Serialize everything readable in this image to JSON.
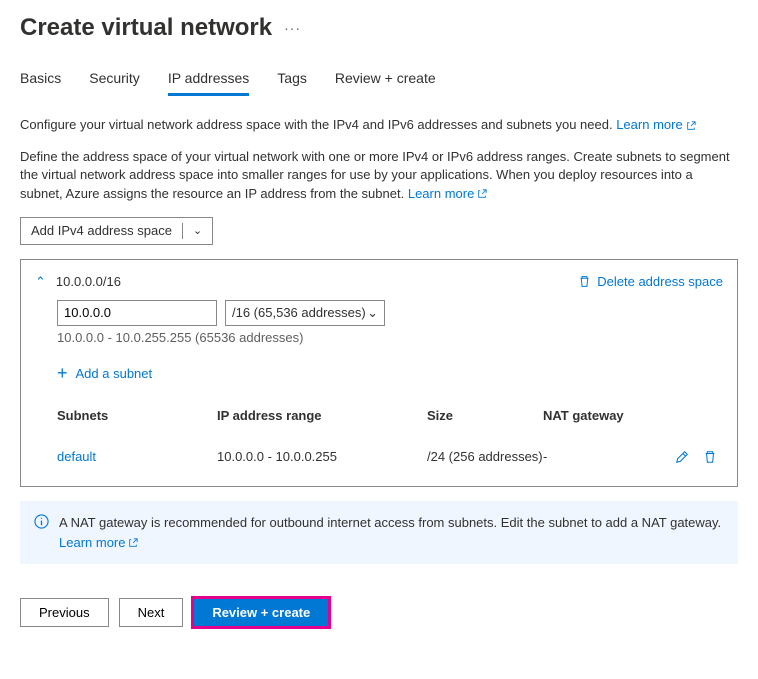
{
  "page": {
    "title": "Create virtual network"
  },
  "tabs": {
    "basics": "Basics",
    "security": "Security",
    "ip": "IP addresses",
    "tags": "Tags",
    "review": "Review + create"
  },
  "intro": {
    "line1": "Configure your virtual network address space with the IPv4 and IPv6 addresses and subnets you need.",
    "learn1": "Learn more",
    "line2": "Define the address space of your virtual network with one or more IPv4 or IPv6 address ranges. Create subnets to segment the virtual network address space into smaller ranges for use by your applications. When you deploy resources into a subnet, Azure assigns the resource an IP address from the subnet.",
    "learn2": "Learn more"
  },
  "addSpaceBtn": "Add IPv4 address space",
  "space": {
    "cidr": "10.0.0.0/16",
    "deleteLabel": "Delete address space",
    "ipValue": "10.0.0.0",
    "prefix": "/16 (65,536 addresses)",
    "rangeText": "10.0.0.0 - 10.0.255.255 (65536 addresses)",
    "addSubnet": "Add a subnet"
  },
  "table": {
    "headers": {
      "subnets": "Subnets",
      "range": "IP address range",
      "size": "Size",
      "nat": "NAT gateway"
    },
    "row": {
      "name": "default",
      "range": "10.0.0.0 - 10.0.0.255",
      "size": "/24 (256 addresses)",
      "nat": "-"
    }
  },
  "info": {
    "text": "A NAT gateway is recommended for outbound internet access from subnets. Edit the subnet to add a NAT gateway.",
    "learn": "Learn more"
  },
  "footer": {
    "previous": "Previous",
    "next": "Next",
    "review": "Review + create"
  }
}
